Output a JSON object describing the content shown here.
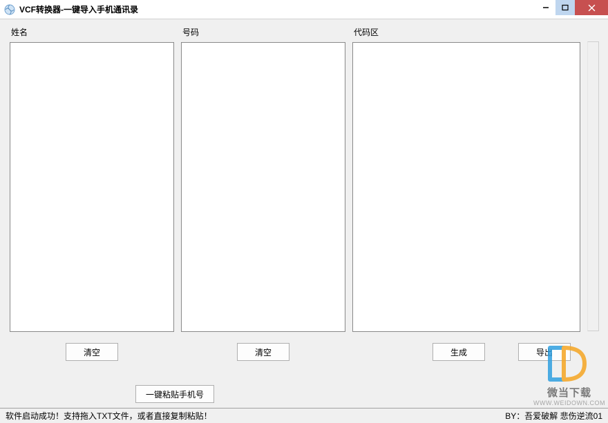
{
  "window": {
    "title": "VCF转换器-一键导入手机通讯录"
  },
  "columns": {
    "name": {
      "label": "姓名",
      "value": ""
    },
    "number": {
      "label": "号码",
      "value": ""
    },
    "code": {
      "label": "代码区",
      "value": ""
    }
  },
  "buttons": {
    "clear_name": "清空",
    "clear_number": "清空",
    "paste_numbers": "一键粘贴手机号",
    "generate": "生成",
    "export": "导出"
  },
  "statusbar": {
    "left": "软件启动成功！支持拖入TXT文件，或者直接复制粘贴！",
    "right": "BY：吾爱破解 悲伤逆流01"
  },
  "watermark": {
    "text": "微当下载",
    "url": "WWW.WEIDOWN.COM"
  }
}
